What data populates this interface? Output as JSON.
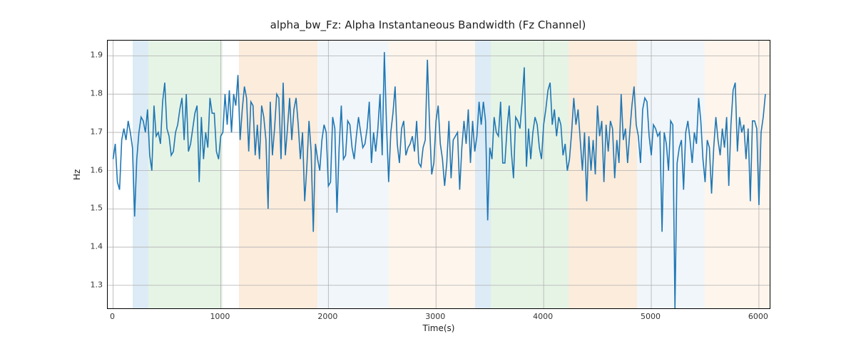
{
  "chart_data": {
    "type": "line",
    "title": "alpha_bw_Fz: Alpha Instantaneous Bandwidth (Fz Channel)",
    "xlabel": "Time(s)",
    "ylabel": "Hz",
    "xlim": [
      -50,
      6100
    ],
    "ylim": [
      1.24,
      1.94
    ],
    "xticks": [
      0,
      1000,
      2000,
      3000,
      4000,
      5000,
      6000
    ],
    "yticks": [
      1.3,
      1.4,
      1.5,
      1.6,
      1.7,
      1.8,
      1.9
    ],
    "bands": [
      {
        "x0": 180,
        "x1": 330,
        "color": "#9cc5e3"
      },
      {
        "x0": 330,
        "x1": 1020,
        "color": "#b7dfb8"
      },
      {
        "x0": 1020,
        "x1": 1170,
        "color": "#ffffff"
      },
      {
        "x0": 1170,
        "x1": 1900,
        "color": "#f7c99a"
      },
      {
        "x0": 1900,
        "x1": 2560,
        "color": "#d8e4f0"
      },
      {
        "x0": 2560,
        "x1": 3360,
        "color": "#fde3c8"
      },
      {
        "x0": 3360,
        "x1": 3510,
        "color": "#9cc5e3"
      },
      {
        "x0": 3510,
        "x1": 4230,
        "color": "#b7dfb8"
      },
      {
        "x0": 4230,
        "x1": 4870,
        "color": "#f7c99a"
      },
      {
        "x0": 4870,
        "x1": 5500,
        "color": "#d8e4f0"
      },
      {
        "x0": 5500,
        "x1": 6100,
        "color": "#fde3c8"
      }
    ],
    "x": [
      0,
      20,
      40,
      60,
      80,
      100,
      120,
      140,
      160,
      180,
      200,
      220,
      240,
      260,
      280,
      300,
      320,
      340,
      360,
      380,
      400,
      420,
      440,
      460,
      480,
      500,
      520,
      540,
      560,
      580,
      600,
      620,
      640,
      660,
      680,
      700,
      720,
      740,
      760,
      780,
      800,
      820,
      840,
      860,
      880,
      900,
      920,
      940,
      960,
      980,
      1000,
      1020,
      1040,
      1060,
      1080,
      1100,
      1120,
      1140,
      1160,
      1180,
      1200,
      1220,
      1240,
      1260,
      1280,
      1300,
      1320,
      1340,
      1360,
      1380,
      1400,
      1420,
      1440,
      1460,
      1480,
      1500,
      1520,
      1540,
      1560,
      1580,
      1600,
      1620,
      1640,
      1660,
      1680,
      1700,
      1720,
      1740,
      1760,
      1780,
      1800,
      1820,
      1840,
      1860,
      1880,
      1900,
      1920,
      1940,
      1960,
      1980,
      2000,
      2020,
      2040,
      2060,
      2080,
      2100,
      2120,
      2140,
      2160,
      2180,
      2200,
      2220,
      2240,
      2260,
      2280,
      2300,
      2320,
      2340,
      2360,
      2380,
      2400,
      2420,
      2440,
      2460,
      2480,
      2500,
      2520,
      2540,
      2560,
      2580,
      2600,
      2620,
      2640,
      2660,
      2680,
      2700,
      2720,
      2740,
      2760,
      2780,
      2800,
      2820,
      2840,
      2860,
      2880,
      2900,
      2920,
      2940,
      2960,
      2980,
      3000,
      3020,
      3040,
      3060,
      3080,
      3100,
      3120,
      3140,
      3160,
      3180,
      3200,
      3220,
      3240,
      3260,
      3280,
      3300,
      3320,
      3340,
      3360,
      3380,
      3400,
      3420,
      3440,
      3460,
      3480,
      3500,
      3520,
      3540,
      3560,
      3580,
      3600,
      3620,
      3640,
      3660,
      3680,
      3700,
      3720,
      3740,
      3760,
      3780,
      3800,
      3820,
      3840,
      3860,
      3880,
      3900,
      3920,
      3940,
      3960,
      3980,
      4000,
      4020,
      4040,
      4060,
      4080,
      4100,
      4120,
      4140,
      4160,
      4180,
      4200,
      4220,
      4240,
      4260,
      4280,
      4300,
      4320,
      4340,
      4360,
      4380,
      4400,
      4420,
      4440,
      4460,
      4480,
      4500,
      4520,
      4540,
      4560,
      4580,
      4600,
      4620,
      4640,
      4660,
      4680,
      4700,
      4720,
      4740,
      4760,
      4780,
      4800,
      4820,
      4840,
      4860,
      4880,
      4900,
      4920,
      4940,
      4960,
      4980,
      5000,
      5020,
      5040,
      5060,
      5080,
      5100,
      5120,
      5140,
      5160,
      5180,
      5200,
      5220,
      5240,
      5260,
      5280,
      5300,
      5320,
      5340,
      5360,
      5380,
      5400,
      5420,
      5440,
      5460,
      5480,
      5500,
      5520,
      5540,
      5560,
      5580,
      5600,
      5620,
      5640,
      5660,
      5680,
      5700,
      5720,
      5740,
      5760,
      5780,
      5800,
      5820,
      5840,
      5860,
      5880,
      5900,
      5920,
      5940,
      5960,
      5980,
      6000,
      6020,
      6040,
      6060
    ],
    "values": [
      1.63,
      1.67,
      1.57,
      1.55,
      1.68,
      1.71,
      1.68,
      1.73,
      1.7,
      1.66,
      1.48,
      1.63,
      1.7,
      1.74,
      1.73,
      1.7,
      1.76,
      1.64,
      1.6,
      1.77,
      1.69,
      1.7,
      1.67,
      1.78,
      1.83,
      1.71,
      1.69,
      1.64,
      1.65,
      1.7,
      1.72,
      1.76,
      1.79,
      1.68,
      1.8,
      1.65,
      1.67,
      1.71,
      1.75,
      1.77,
      1.57,
      1.74,
      1.63,
      1.7,
      1.66,
      1.79,
      1.75,
      1.75,
      1.65,
      1.63,
      1.69,
      1.7,
      1.8,
      1.72,
      1.81,
      1.7,
      1.8,
      1.77,
      1.85,
      1.68,
      1.76,
      1.82,
      1.79,
      1.65,
      1.78,
      1.77,
      1.64,
      1.72,
      1.63,
      1.77,
      1.74,
      1.68,
      1.5,
      1.78,
      1.64,
      1.71,
      1.8,
      1.79,
      1.63,
      1.83,
      1.64,
      1.71,
      1.79,
      1.68,
      1.76,
      1.79,
      1.72,
      1.63,
      1.7,
      1.52,
      1.61,
      1.73,
      1.65,
      1.44,
      1.67,
      1.63,
      1.6,
      1.68,
      1.72,
      1.7,
      1.56,
      1.57,
      1.74,
      1.71,
      1.49,
      1.66,
      1.77,
      1.63,
      1.64,
      1.73,
      1.72,
      1.66,
      1.63,
      1.69,
      1.74,
      1.7,
      1.66,
      1.67,
      1.71,
      1.78,
      1.62,
      1.7,
      1.65,
      1.71,
      1.8,
      1.64,
      1.91,
      1.72,
      1.57,
      1.7,
      1.75,
      1.82,
      1.67,
      1.62,
      1.71,
      1.73,
      1.64,
      1.66,
      1.67,
      1.69,
      1.65,
      1.73,
      1.62,
      1.61,
      1.66,
      1.68,
      1.89,
      1.72,
      1.59,
      1.62,
      1.73,
      1.77,
      1.67,
      1.63,
      1.56,
      1.62,
      1.73,
      1.58,
      1.68,
      1.69,
      1.7,
      1.55,
      1.66,
      1.73,
      1.67,
      1.76,
      1.62,
      1.73,
      1.65,
      1.69,
      1.78,
      1.72,
      1.78,
      1.73,
      1.47,
      1.66,
      1.63,
      1.74,
      1.7,
      1.69,
      1.78,
      1.62,
      1.62,
      1.71,
      1.77,
      1.65,
      1.58,
      1.74,
      1.73,
      1.71,
      1.78,
      1.87,
      1.61,
      1.71,
      1.63,
      1.7,
      1.74,
      1.72,
      1.66,
      1.63,
      1.72,
      1.76,
      1.81,
      1.83,
      1.72,
      1.76,
      1.69,
      1.74,
      1.72,
      1.64,
      1.67,
      1.6,
      1.63,
      1.7,
      1.79,
      1.72,
      1.76,
      1.68,
      1.6,
      1.7,
      1.52,
      1.69,
      1.6,
      1.68,
      1.59,
      1.77,
      1.69,
      1.73,
      1.57,
      1.72,
      1.65,
      1.73,
      1.71,
      1.58,
      1.68,
      1.62,
      1.8,
      1.68,
      1.71,
      1.62,
      1.7,
      1.77,
      1.82,
      1.72,
      1.69,
      1.62,
      1.76,
      1.79,
      1.78,
      1.69,
      1.64,
      1.72,
      1.71,
      1.69,
      1.7,
      1.44,
      1.7,
      1.67,
      1.6,
      1.73,
      1.72,
      1.24,
      1.62,
      1.66,
      1.68,
      1.55,
      1.7,
      1.73,
      1.68,
      1.62,
      1.7,
      1.67,
      1.79,
      1.73,
      1.63,
      1.57,
      1.68,
      1.66,
      1.54,
      1.66,
      1.74,
      1.68,
      1.64,
      1.71,
      1.66,
      1.74,
      1.56,
      1.72,
      1.81,
      1.83,
      1.65,
      1.74,
      1.7,
      1.72,
      1.63,
      1.71,
      1.52,
      1.73,
      1.73,
      1.71,
      1.51,
      1.7,
      1.74,
      1.8
    ]
  }
}
